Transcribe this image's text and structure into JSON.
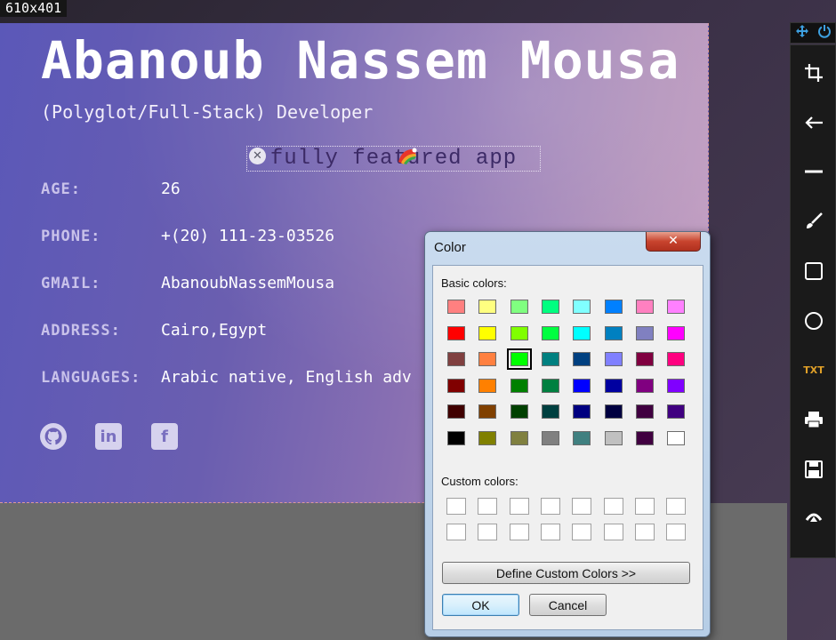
{
  "overlay": {
    "size_label": "610x401"
  },
  "capture": {
    "name": "Abanoub Nassem Mousa",
    "role": "(Polyglot/Full-Stack) Developer",
    "info": [
      {
        "label": "AGE:",
        "value": "26"
      },
      {
        "label": "PHONE:",
        "value": "+(20) 111-23-03526"
      },
      {
        "label": "GMAIL:",
        "value": "AbanoubNassemMousa"
      },
      {
        "label": "ADDRESS:",
        "value": "Cairo,Egypt"
      },
      {
        "label": "LANGUAGES:",
        "value": "Arabic native, English adv"
      }
    ],
    "social": [
      "github-icon",
      "linkedin-icon",
      "facebook-icon"
    ]
  },
  "annotation": {
    "text": "fully featured app",
    "close_icon": "close-icon",
    "color_icon": "color-palette-icon"
  },
  "toolbar": {
    "top": [
      "move-icon",
      "power-icon"
    ],
    "tools": [
      "crop-icon",
      "arrow-left-icon",
      "line-icon",
      "brush-icon",
      "rectangle-icon",
      "ellipse-icon",
      "TXT",
      "print-icon",
      "save-icon",
      "upload-icon"
    ]
  },
  "dialog": {
    "title": "Color",
    "close": "✕",
    "basic_label": "Basic colors:",
    "custom_label": "Custom colors:",
    "define_button": "Define Custom Colors >>",
    "ok_button": "OK",
    "cancel_button": "Cancel",
    "basic_colors": [
      [
        "#ff8080",
        "#ffff80",
        "#80ff80",
        "#00ff80",
        "#80ffff",
        "#0080ff",
        "#ff80c0",
        "#ff80ff"
      ],
      [
        "#ff0000",
        "#ffff00",
        "#80ff00",
        "#00ff40",
        "#00ffff",
        "#0080c0",
        "#8080c0",
        "#ff00ff"
      ],
      [
        "#804040",
        "#ff8040",
        "#00ff00",
        "#008080",
        "#004080",
        "#8080ff",
        "#800040",
        "#ff0080"
      ],
      [
        "#800000",
        "#ff8000",
        "#008000",
        "#008040",
        "#0000ff",
        "#0000a0",
        "#800080",
        "#8000ff"
      ],
      [
        "#400000",
        "#804000",
        "#004000",
        "#004040",
        "#000080",
        "#000040",
        "#400040",
        "#400080"
      ],
      [
        "#000000",
        "#808000",
        "#808040",
        "#808080",
        "#408080",
        "#c0c0c0",
        "#400040",
        "#ffffff"
      ]
    ],
    "selected": [
      2,
      2
    ]
  }
}
